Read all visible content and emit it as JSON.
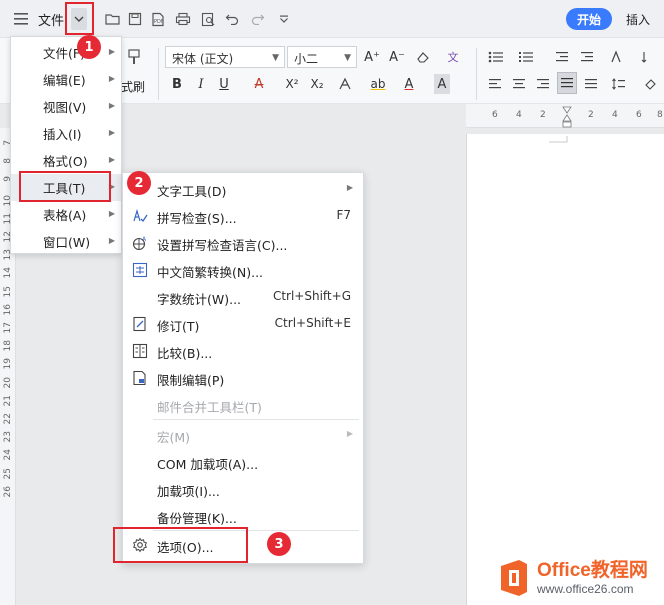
{
  "titlebar": {
    "file_label": "文件",
    "tabs": {
      "start": "开始",
      "insert": "插入"
    }
  },
  "ribbon": {
    "font_name": "宋体 (正文)",
    "font_size": "小二",
    "format_brush_label": "式刷",
    "buttons": {
      "bold": "B",
      "italic": "I",
      "underline": "U",
      "strike": "A",
      "superscript": "X²",
      "subscript": "X₂",
      "grow_font": "A⁺",
      "shrink_font": "A⁻",
      "highlight": "ab",
      "font_color": "A",
      "char_shading": "A",
      "phonetic": "文"
    }
  },
  "ruler": {
    "h_marks": [
      "6",
      "4",
      "2",
      "2",
      "4",
      "6",
      "8"
    ],
    "v_marks": [
      "7",
      "8",
      "9",
      "10",
      "11",
      "12",
      "13",
      "14",
      "15",
      "16",
      "17",
      "18",
      "19",
      "20",
      "21",
      "22",
      "23",
      "24",
      "25",
      "26"
    ]
  },
  "main_menu": {
    "items": [
      {
        "label": "文件(F)",
        "has_submenu": true,
        "active": false
      },
      {
        "label": "编辑(E)",
        "has_submenu": true,
        "active": false
      },
      {
        "label": "视图(V)",
        "has_submenu": true,
        "active": false
      },
      {
        "label": "插入(I)",
        "has_submenu": true,
        "active": false
      },
      {
        "label": "格式(O)",
        "has_submenu": true,
        "active": false
      },
      {
        "label": "工具(T)",
        "has_submenu": true,
        "active": true
      },
      {
        "label": "表格(A)",
        "has_submenu": true,
        "active": false
      },
      {
        "label": "窗口(W)",
        "has_submenu": true,
        "active": false
      }
    ]
  },
  "tools_menu": {
    "items": [
      {
        "label": "文字工具(D)",
        "shortcut": "",
        "icon": "none",
        "has_submenu": true,
        "disabled": false
      },
      {
        "label": "拼写检查(S)...",
        "shortcut": "F7",
        "icon": "spellcheck-icon",
        "has_submenu": false,
        "disabled": false
      },
      {
        "label": "设置拼写检查语言(C)...",
        "shortcut": "",
        "icon": "language-globe-icon",
        "has_submenu": false,
        "disabled": false
      },
      {
        "label": "中文简繁转换(N)...",
        "shortcut": "",
        "icon": "chinese-convert-icon",
        "has_submenu": false,
        "disabled": false
      },
      {
        "label": "字数统计(W)...",
        "shortcut": "Ctrl+Shift+G",
        "icon": "none",
        "has_submenu": false,
        "disabled": false
      },
      {
        "label": "修订(T)",
        "shortcut": "Ctrl+Shift+E",
        "icon": "track-changes-icon",
        "has_submenu": false,
        "disabled": false
      },
      {
        "label": "比较(B)...",
        "shortcut": "",
        "icon": "compare-icon",
        "has_submenu": false,
        "disabled": false
      },
      {
        "label": "限制编辑(P)",
        "shortcut": "",
        "icon": "restrict-edit-icon",
        "has_submenu": false,
        "disabled": false
      },
      {
        "label": "邮件合并工具栏(T)",
        "shortcut": "",
        "icon": "none",
        "has_submenu": false,
        "disabled": true
      },
      {
        "label": "宏(M)",
        "shortcut": "",
        "icon": "none",
        "has_submenu": true,
        "disabled": true
      },
      {
        "label": "COM 加载项(A)...",
        "shortcut": "",
        "icon": "none",
        "has_submenu": false,
        "disabled": false
      },
      {
        "label": "加载项(I)...",
        "shortcut": "",
        "icon": "none",
        "has_submenu": false,
        "disabled": false
      },
      {
        "label": "备份管理(K)...",
        "shortcut": "",
        "icon": "none",
        "has_submenu": false,
        "disabled": false
      },
      {
        "label": "选项(O)...",
        "shortcut": "",
        "icon": "gear-icon",
        "has_submenu": false,
        "disabled": false
      }
    ]
  },
  "annotations": {
    "step1": "1",
    "step2": "2",
    "step3": "3",
    "color": "#e0252f"
  },
  "watermark": {
    "brand": "Office教程网",
    "url": "www.office26.com"
  },
  "colors": {
    "accent": "#3a7bfd",
    "annotation_red": "#e0252f",
    "watermark_orange": "#f0642a"
  }
}
